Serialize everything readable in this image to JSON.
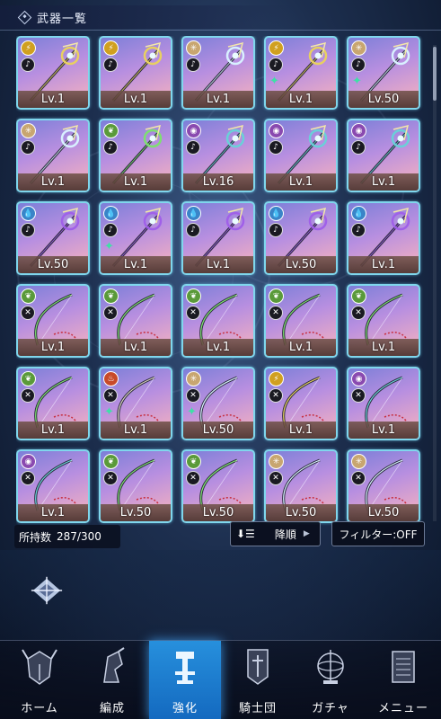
{
  "header": {
    "title": "武器一覧"
  },
  "weapons": [
    {
      "level": "Lv.1",
      "element": "lightning",
      "element_color": "#d0a020",
      "weapon_type": "staff",
      "gem": false
    },
    {
      "level": "Lv.1",
      "element": "lightning",
      "element_color": "#d0a020",
      "weapon_type": "staff",
      "gem": false
    },
    {
      "level": "Lv.1",
      "element": "light",
      "element_color": "#c8a670",
      "weapon_type": "staff",
      "gem": false
    },
    {
      "level": "Lv.1",
      "element": "lightning",
      "element_color": "#d0a020",
      "weapon_type": "staff",
      "gem": true
    },
    {
      "level": "Lv.50",
      "element": "light",
      "element_color": "#c8a670",
      "weapon_type": "staff",
      "gem": true
    },
    {
      "level": "Lv.1",
      "element": "light",
      "element_color": "#c8a670",
      "weapon_type": "staff",
      "gem": false
    },
    {
      "level": "Lv.1",
      "element": "wind",
      "element_color": "#5a9a3a",
      "weapon_type": "staff",
      "gem": false
    },
    {
      "level": "Lv.16",
      "element": "dark",
      "element_color": "#8a4ab0",
      "weapon_type": "staff",
      "gem": false
    },
    {
      "level": "Lv.1",
      "element": "dark",
      "element_color": "#8a4ab0",
      "weapon_type": "staff",
      "gem": false
    },
    {
      "level": "Lv.1",
      "element": "dark",
      "element_color": "#8a4ab0",
      "weapon_type": "staff",
      "gem": false
    },
    {
      "level": "Lv.50",
      "element": "water",
      "element_color": "#3a84c8",
      "weapon_type": "staff",
      "gem": false
    },
    {
      "level": "Lv.1",
      "element": "water",
      "element_color": "#3a84c8",
      "weapon_type": "staff",
      "gem": true
    },
    {
      "level": "Lv.1",
      "element": "water",
      "element_color": "#3a84c8",
      "weapon_type": "staff",
      "gem": false
    },
    {
      "level": "Lv.50",
      "element": "water",
      "element_color": "#3a84c8",
      "weapon_type": "staff",
      "gem": false
    },
    {
      "level": "Lv.1",
      "element": "water",
      "element_color": "#3a84c8",
      "weapon_type": "staff",
      "gem": false
    },
    {
      "level": "Lv.1",
      "element": "wind",
      "element_color": "#5a9a3a",
      "weapon_type": "bow",
      "gem": false
    },
    {
      "level": "Lv.1",
      "element": "wind",
      "element_color": "#5a9a3a",
      "weapon_type": "bow",
      "gem": false
    },
    {
      "level": "Lv.1",
      "element": "wind",
      "element_color": "#5a9a3a",
      "weapon_type": "bow",
      "gem": false
    },
    {
      "level": "Lv.1",
      "element": "wind",
      "element_color": "#5a9a3a",
      "weapon_type": "bow",
      "gem": false
    },
    {
      "level": "Lv.1",
      "element": "wind",
      "element_color": "#5a9a3a",
      "weapon_type": "bow",
      "gem": false
    },
    {
      "level": "Lv.1",
      "element": "wind",
      "element_color": "#5a9a3a",
      "weapon_type": "bow",
      "gem": false
    },
    {
      "level": "Lv.1",
      "element": "fire",
      "element_color": "#c84a2a",
      "weapon_type": "bow",
      "gem": true
    },
    {
      "level": "Lv.50",
      "element": "light",
      "element_color": "#c8a670",
      "weapon_type": "bow",
      "gem": true
    },
    {
      "level": "Lv.1",
      "element": "lightning",
      "element_color": "#d0a020",
      "weapon_type": "bow",
      "gem": false
    },
    {
      "level": "Lv.1",
      "element": "dark",
      "element_color": "#8a4ab0",
      "weapon_type": "bow",
      "gem": false
    },
    {
      "level": "Lv.1",
      "element": "dark",
      "element_color": "#8a4ab0",
      "weapon_type": "bow",
      "gem": false
    },
    {
      "level": "Lv.50",
      "element": "wind",
      "element_color": "#5a9a3a",
      "weapon_type": "bow",
      "gem": false
    },
    {
      "level": "Lv.50",
      "element": "wind",
      "element_color": "#5a9a3a",
      "weapon_type": "bow",
      "gem": false
    },
    {
      "level": "Lv.50",
      "element": "light",
      "element_color": "#c8a670",
      "weapon_type": "bow",
      "gem": false
    },
    {
      "level": "Lv.50",
      "element": "light",
      "element_color": "#c8a670",
      "weapon_type": "bow",
      "gem": false
    }
  ],
  "inventory": {
    "count_label": "所持数",
    "count_value": "287/300"
  },
  "sort": {
    "label": "降順"
  },
  "filter": {
    "label": "フィルター:OFF"
  },
  "colors": {
    "card_border": "#7fd6ec",
    "active_tab": "#2a8ee0",
    "gem": "#3fe0a6"
  },
  "nav": {
    "active": "enhance",
    "items": [
      {
        "id": "home",
        "label": "ホーム",
        "icon": "helmet-icon"
      },
      {
        "id": "formation",
        "label": "編成",
        "icon": "knight-icon"
      },
      {
        "id": "enhance",
        "label": "強化",
        "icon": "forge-icon"
      },
      {
        "id": "order",
        "label": "騎士団",
        "icon": "banner-icon"
      },
      {
        "id": "gacha",
        "label": "ガチャ",
        "icon": "astrolabe-icon"
      },
      {
        "id": "menu",
        "label": "メニュー",
        "icon": "book-icon"
      }
    ]
  }
}
